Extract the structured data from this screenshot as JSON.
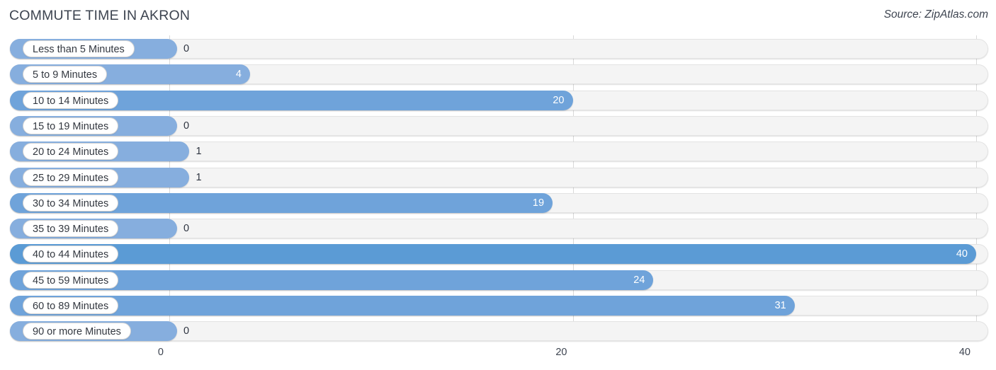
{
  "header": {
    "title": "COMMUTE TIME IN AKRON",
    "source": "Source: ZipAtlas.com"
  },
  "axis": {
    "ticks": [
      "0",
      "20",
      "40"
    ],
    "tick_values": [
      0,
      20,
      40
    ],
    "min": 0,
    "max": 40
  },
  "colors": {
    "bar": "#86aede",
    "bar_dark": "#5b9bd5",
    "track": "#f4f4f4",
    "gridline": "#d9d9d9",
    "title": "#3d4450",
    "label_text": "#333840",
    "value_inside": "#ffffff"
  },
  "chart_data": {
    "type": "bar",
    "orientation": "horizontal",
    "title": "COMMUTE TIME IN AKRON",
    "subtitle": "Source: ZipAtlas.com",
    "xlabel": "",
    "ylabel": "",
    "xlim": [
      0,
      40
    ],
    "grid": true,
    "legend": "none",
    "xticks": [
      0,
      20,
      40
    ],
    "categories": [
      "Less than 5 Minutes",
      "5 to 9 Minutes",
      "10 to 14 Minutes",
      "15 to 19 Minutes",
      "20 to 24 Minutes",
      "25 to 29 Minutes",
      "30 to 34 Minutes",
      "35 to 39 Minutes",
      "40 to 44 Minutes",
      "45 to 59 Minutes",
      "60 to 89 Minutes",
      "90 or more Minutes"
    ],
    "values": [
      0,
      4,
      20,
      0,
      1,
      1,
      19,
      0,
      40,
      24,
      31,
      0
    ],
    "value_labels": [
      "0",
      "4",
      "20",
      "0",
      "1",
      "1",
      "19",
      "0",
      "40",
      "24",
      "31",
      "0"
    ]
  }
}
